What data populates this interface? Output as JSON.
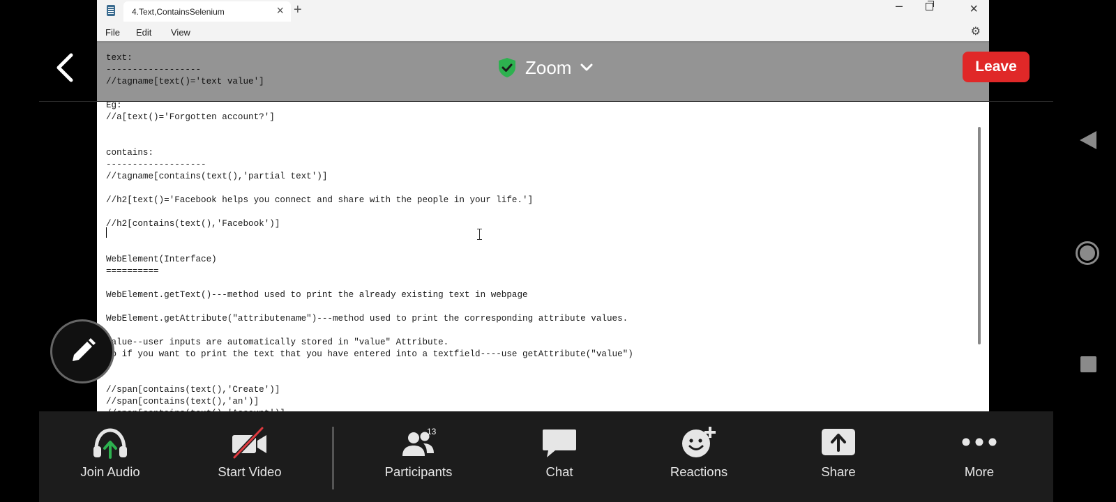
{
  "notepad": {
    "tab_title": "4.Text,ContainsSelenium",
    "menu": {
      "file": "File",
      "edit": "Edit",
      "view": "View"
    },
    "text": "text:\n------------------\n//tagname[text()='text value']\n\nEg:\n//a[text()='Forgotten account?']\n\n\ncontains:\n-------------------\n//tagname[contains(text(),'partial text')]\n\n//h2[text()='Facebook helps you connect and share with the people in your life.']\n\n//h2[contains(text(),'Facebook')]\n\n\nWebElement(Interface)\n==========\n\nWebElement.getText()---method used to print the already existing text in webpage\n\nWebElement.getAttribute(\"attributename\")---method used to print the corresponding attribute values.\n\nvalue--user inputs are automatically stored in \"value\" Attribute.\nso if you want to print the text that you have entered into a textfield----use getAttribute(\"value\")\n\n\n//span[contains(text(),'Create')]\n//span[contains(text(),'an')]\n//span[contains(text(),'Account')]"
  },
  "zoom": {
    "title": "Zoom",
    "leave_label": "Leave",
    "toolbar": [
      {
        "id": "join-audio",
        "label": "Join Audio",
        "icon": "headphones-icon"
      },
      {
        "id": "start-video",
        "label": "Start Video",
        "icon": "video-off-icon"
      },
      {
        "id": "participants",
        "label": "Participants",
        "icon": "participants-icon",
        "count": "13"
      },
      {
        "id": "chat",
        "label": "Chat",
        "icon": "chat-icon"
      },
      {
        "id": "reactions",
        "label": "Reactions",
        "icon": "reaction-icon"
      },
      {
        "id": "share",
        "label": "Share",
        "icon": "share-icon"
      },
      {
        "id": "more",
        "label": "More",
        "icon": "more-icon"
      }
    ]
  },
  "colors": {
    "leave": "#e02828",
    "shield": "#2db14f",
    "audio_arrow": "#2db14f",
    "video_slash": "#e0393e",
    "toolbar_bg": "#1c1c1c"
  }
}
